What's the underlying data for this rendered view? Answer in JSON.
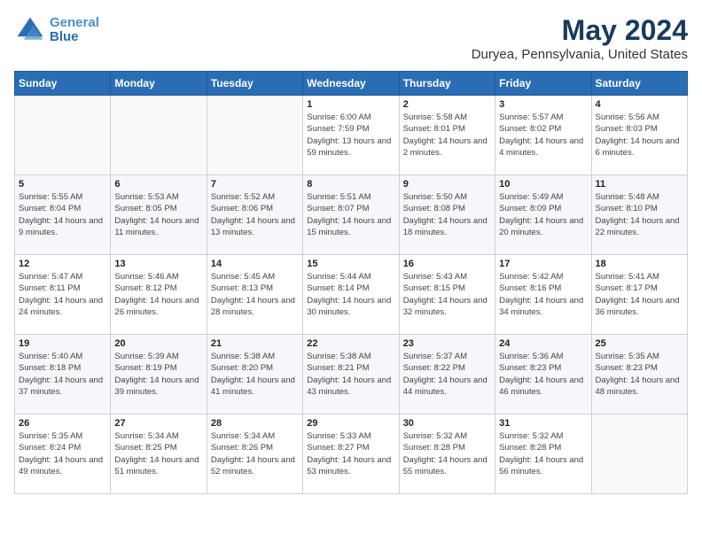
{
  "header": {
    "logo_line1": "General",
    "logo_line2": "Blue",
    "title": "May 2024",
    "subtitle": "Duryea, Pennsylvania, United States"
  },
  "weekdays": [
    "Sunday",
    "Monday",
    "Tuesday",
    "Wednesday",
    "Thursday",
    "Friday",
    "Saturday"
  ],
  "weeks": [
    [
      {
        "day": "",
        "sunrise": "",
        "sunset": "",
        "daylight": ""
      },
      {
        "day": "",
        "sunrise": "",
        "sunset": "",
        "daylight": ""
      },
      {
        "day": "",
        "sunrise": "",
        "sunset": "",
        "daylight": ""
      },
      {
        "day": "1",
        "sunrise": "Sunrise: 6:00 AM",
        "sunset": "Sunset: 7:59 PM",
        "daylight": "Daylight: 13 hours and 59 minutes."
      },
      {
        "day": "2",
        "sunrise": "Sunrise: 5:58 AM",
        "sunset": "Sunset: 8:01 PM",
        "daylight": "Daylight: 14 hours and 2 minutes."
      },
      {
        "day": "3",
        "sunrise": "Sunrise: 5:57 AM",
        "sunset": "Sunset: 8:02 PM",
        "daylight": "Daylight: 14 hours and 4 minutes."
      },
      {
        "day": "4",
        "sunrise": "Sunrise: 5:56 AM",
        "sunset": "Sunset: 8:03 PM",
        "daylight": "Daylight: 14 hours and 6 minutes."
      }
    ],
    [
      {
        "day": "5",
        "sunrise": "Sunrise: 5:55 AM",
        "sunset": "Sunset: 8:04 PM",
        "daylight": "Daylight: 14 hours and 9 minutes."
      },
      {
        "day": "6",
        "sunrise": "Sunrise: 5:53 AM",
        "sunset": "Sunset: 8:05 PM",
        "daylight": "Daylight: 14 hours and 11 minutes."
      },
      {
        "day": "7",
        "sunrise": "Sunrise: 5:52 AM",
        "sunset": "Sunset: 8:06 PM",
        "daylight": "Daylight: 14 hours and 13 minutes."
      },
      {
        "day": "8",
        "sunrise": "Sunrise: 5:51 AM",
        "sunset": "Sunset: 8:07 PM",
        "daylight": "Daylight: 14 hours and 15 minutes."
      },
      {
        "day": "9",
        "sunrise": "Sunrise: 5:50 AM",
        "sunset": "Sunset: 8:08 PM",
        "daylight": "Daylight: 14 hours and 18 minutes."
      },
      {
        "day": "10",
        "sunrise": "Sunrise: 5:49 AM",
        "sunset": "Sunset: 8:09 PM",
        "daylight": "Daylight: 14 hours and 20 minutes."
      },
      {
        "day": "11",
        "sunrise": "Sunrise: 5:48 AM",
        "sunset": "Sunset: 8:10 PM",
        "daylight": "Daylight: 14 hours and 22 minutes."
      }
    ],
    [
      {
        "day": "12",
        "sunrise": "Sunrise: 5:47 AM",
        "sunset": "Sunset: 8:11 PM",
        "daylight": "Daylight: 14 hours and 24 minutes."
      },
      {
        "day": "13",
        "sunrise": "Sunrise: 5:46 AM",
        "sunset": "Sunset: 8:12 PM",
        "daylight": "Daylight: 14 hours and 26 minutes."
      },
      {
        "day": "14",
        "sunrise": "Sunrise: 5:45 AM",
        "sunset": "Sunset: 8:13 PM",
        "daylight": "Daylight: 14 hours and 28 minutes."
      },
      {
        "day": "15",
        "sunrise": "Sunrise: 5:44 AM",
        "sunset": "Sunset: 8:14 PM",
        "daylight": "Daylight: 14 hours and 30 minutes."
      },
      {
        "day": "16",
        "sunrise": "Sunrise: 5:43 AM",
        "sunset": "Sunset: 8:15 PM",
        "daylight": "Daylight: 14 hours and 32 minutes."
      },
      {
        "day": "17",
        "sunrise": "Sunrise: 5:42 AM",
        "sunset": "Sunset: 8:16 PM",
        "daylight": "Daylight: 14 hours and 34 minutes."
      },
      {
        "day": "18",
        "sunrise": "Sunrise: 5:41 AM",
        "sunset": "Sunset: 8:17 PM",
        "daylight": "Daylight: 14 hours and 36 minutes."
      }
    ],
    [
      {
        "day": "19",
        "sunrise": "Sunrise: 5:40 AM",
        "sunset": "Sunset: 8:18 PM",
        "daylight": "Daylight: 14 hours and 37 minutes."
      },
      {
        "day": "20",
        "sunrise": "Sunrise: 5:39 AM",
        "sunset": "Sunset: 8:19 PM",
        "daylight": "Daylight: 14 hours and 39 minutes."
      },
      {
        "day": "21",
        "sunrise": "Sunrise: 5:38 AM",
        "sunset": "Sunset: 8:20 PM",
        "daylight": "Daylight: 14 hours and 41 minutes."
      },
      {
        "day": "22",
        "sunrise": "Sunrise: 5:38 AM",
        "sunset": "Sunset: 8:21 PM",
        "daylight": "Daylight: 14 hours and 43 minutes."
      },
      {
        "day": "23",
        "sunrise": "Sunrise: 5:37 AM",
        "sunset": "Sunset: 8:22 PM",
        "daylight": "Daylight: 14 hours and 44 minutes."
      },
      {
        "day": "24",
        "sunrise": "Sunrise: 5:36 AM",
        "sunset": "Sunset: 8:23 PM",
        "daylight": "Daylight: 14 hours and 46 minutes."
      },
      {
        "day": "25",
        "sunrise": "Sunrise: 5:35 AM",
        "sunset": "Sunset: 8:23 PM",
        "daylight": "Daylight: 14 hours and 48 minutes."
      }
    ],
    [
      {
        "day": "26",
        "sunrise": "Sunrise: 5:35 AM",
        "sunset": "Sunset: 8:24 PM",
        "daylight": "Daylight: 14 hours and 49 minutes."
      },
      {
        "day": "27",
        "sunrise": "Sunrise: 5:34 AM",
        "sunset": "Sunset: 8:25 PM",
        "daylight": "Daylight: 14 hours and 51 minutes."
      },
      {
        "day": "28",
        "sunrise": "Sunrise: 5:34 AM",
        "sunset": "Sunset: 8:26 PM",
        "daylight": "Daylight: 14 hours and 52 minutes."
      },
      {
        "day": "29",
        "sunrise": "Sunrise: 5:33 AM",
        "sunset": "Sunset: 8:27 PM",
        "daylight": "Daylight: 14 hours and 53 minutes."
      },
      {
        "day": "30",
        "sunrise": "Sunrise: 5:32 AM",
        "sunset": "Sunset: 8:28 PM",
        "daylight": "Daylight: 14 hours and 55 minutes."
      },
      {
        "day": "31",
        "sunrise": "Sunrise: 5:32 AM",
        "sunset": "Sunset: 8:28 PM",
        "daylight": "Daylight: 14 hours and 56 minutes."
      },
      {
        "day": "",
        "sunrise": "",
        "sunset": "",
        "daylight": ""
      }
    ]
  ]
}
